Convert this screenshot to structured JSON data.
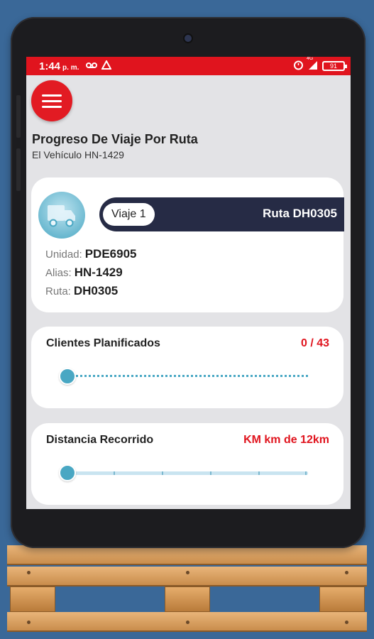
{
  "status_bar": {
    "time": "1:44",
    "ampm": "p. m.",
    "voicemail_icon": "voicemail-icon",
    "drive_icon": "drive-icon",
    "alarm_icon": "alarm-icon",
    "signal_icon": "signal-icon",
    "network": "4G",
    "battery": "91"
  },
  "header": {
    "menu_icon": "hamburger-menu-icon",
    "title": "Progreso De Viaje Por Ruta",
    "subtitle": "El Vehículo HN-1429"
  },
  "vehicle_card": {
    "icon": "truck-icon",
    "trip_label": "Viaje 1",
    "route_label": "Ruta DH0305",
    "unidad_label": "Unidad:",
    "unidad_value": "PDE6905",
    "alias_label": "Alias:",
    "alias_value": "HN-1429",
    "ruta_label": "Ruta:",
    "ruta_value": "DH0305"
  },
  "clients_card": {
    "label": "Clientes Planificados",
    "value": "0 / 43",
    "progress": 0
  },
  "distance_card": {
    "label": "Distancia Recorrido",
    "value": "KM km de 12km",
    "progress": 0
  },
  "colors": {
    "primary_red": "#e0141e",
    "navy": "#262b45",
    "teal": "#49a7c3"
  }
}
